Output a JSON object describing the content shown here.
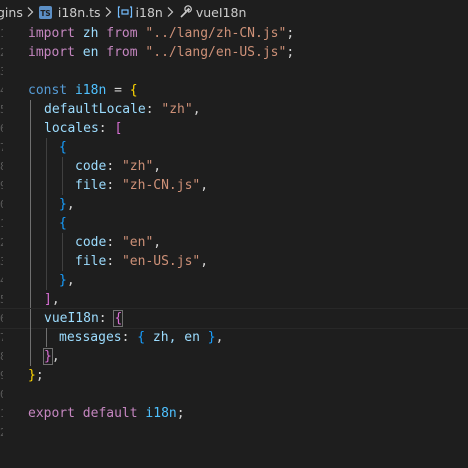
{
  "breadcrumb": {
    "folder": "gins",
    "file_icon": "TS",
    "file": "i18n.ts",
    "symbol": "i18n",
    "property": "vueI18n"
  },
  "code": {
    "l1": {
      "kw": "import",
      "id": "zh",
      "from": "from",
      "str": "\"../lang/zh-CN.js\"",
      "end": ";"
    },
    "l2": {
      "kw": "import",
      "id": "en",
      "from": "from",
      "str": "\"../lang/en-US.js\"",
      "end": ";"
    },
    "l4": {
      "kw": "const",
      "id": "i18n",
      "eq": " = ",
      "brace": "{"
    },
    "l5": {
      "key": "defaultLocale",
      "colon": ": ",
      "str": "\"zh\"",
      "end": ","
    },
    "l6": {
      "key": "locales",
      "colon": ": ",
      "bracket": "["
    },
    "l7": {
      "brace": "{"
    },
    "l8": {
      "key": "code",
      "colon": ": ",
      "str": "\"zh\"",
      "end": ","
    },
    "l9": {
      "key": "file",
      "colon": ": ",
      "str": "\"zh-CN.js\"",
      "end": ","
    },
    "l10": {
      "brace": "}",
      "end": ","
    },
    "l11": {
      "brace": "{"
    },
    "l12": {
      "key": "code",
      "colon": ": ",
      "str": "\"en\"",
      "end": ","
    },
    "l13": {
      "key": "file",
      "colon": ": ",
      "str": "\"en-US.js\"",
      "end": ","
    },
    "l14": {
      "brace": "}",
      "end": ","
    },
    "l15": {
      "bracket": "]",
      "end": ","
    },
    "l16": {
      "key": "vueI18n",
      "colon": ": ",
      "brace": "{"
    },
    "l17": {
      "key": "messages",
      "colon": ": ",
      "open": "{",
      "body": " zh, en ",
      "close": "}",
      "end": ","
    },
    "l18": {
      "brace": "}",
      "end": ","
    },
    "l19": {
      "brace": "}",
      "end": ";"
    },
    "l21": {
      "kw": "export",
      "kw2": "default",
      "id": "i18n",
      "end": ";"
    }
  },
  "colors": {
    "background": "#1e1e1e",
    "keyword": "#569cd6",
    "control_keyword": "#c586c0",
    "string": "#ce9178",
    "property": "#9cdcfe",
    "constant": "#4fc1ff",
    "bracket_level1": "#ffd700",
    "bracket_level2": "#da70d6",
    "bracket_level3": "#179fff"
  }
}
